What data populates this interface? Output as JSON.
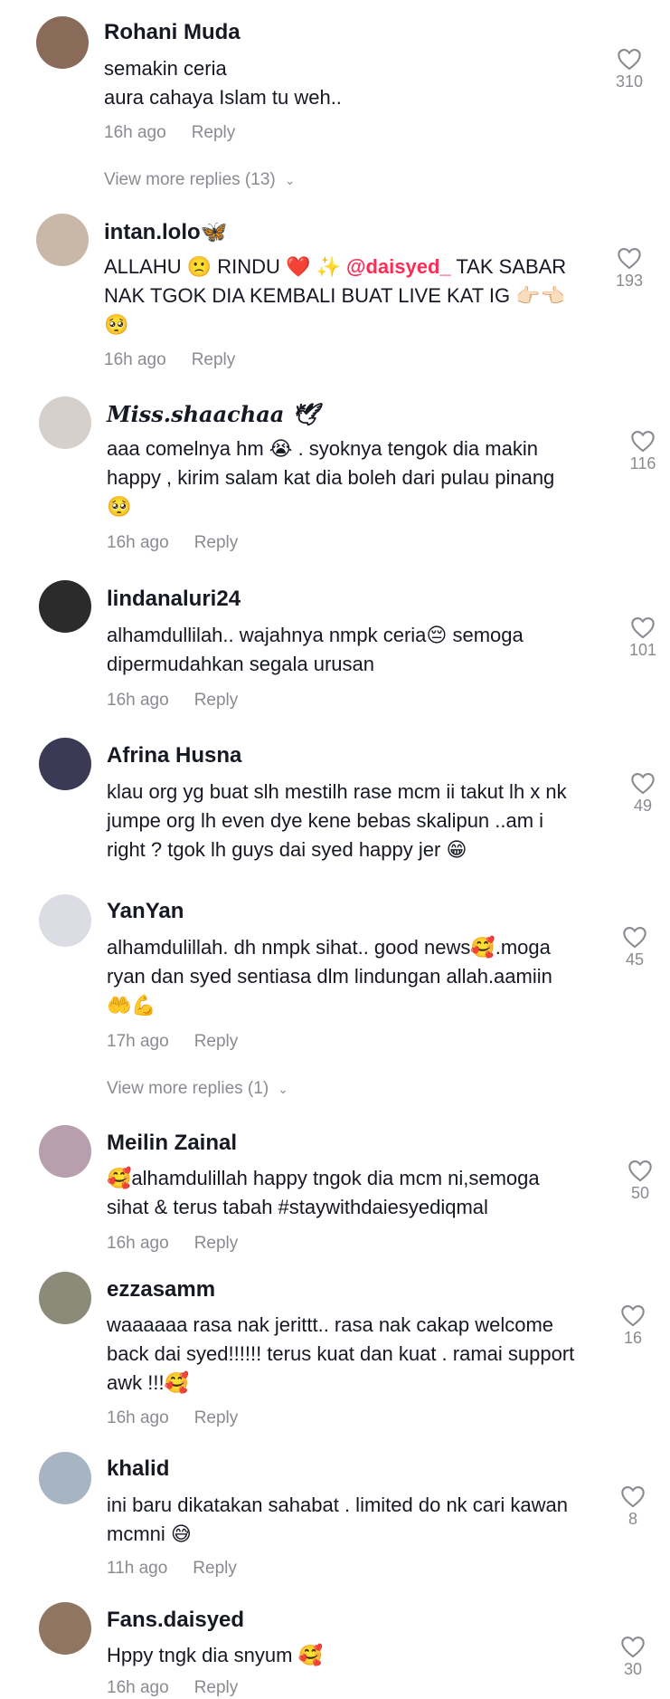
{
  "comments": [
    {
      "user": "Rohani Muda",
      "line1": "semakin ceria",
      "line2": "aura cahaya Islam tu weh..",
      "line3": "",
      "time": "16h ago",
      "reply": "Reply",
      "likes": "310",
      "more": "View more replies (13)",
      "avatar_color": "#8a6b5a"
    },
    {
      "user": "intan.lolo🦋",
      "line1": "ALLAHU 🙁 RINDU ❤️ ✨ ",
      "mention": "@daisyed_",
      "line1b": " TAK SABAR",
      "line2": "NAK TGOK DIA KEMBALI BUAT LIVE KAT IG 👉🏻👈🏻",
      "line3": "🥺",
      "time": "16h ago",
      "reply": "Reply",
      "likes": "193",
      "more": "",
      "avatar_color": "#c9b7a8"
    },
    {
      "user": "𝑴𝒊𝒔𝒔.𝒔𝒉𝒂𝒂𝒄𝒉𝒂𝒂 🕊",
      "line1": "aaa comelnya hm 😭 . syoknya tengok dia makin",
      "line2": "happy , kirim salam kat dia boleh dari pulau pinang",
      "line3": "🥺",
      "time": "16h ago",
      "reply": "Reply",
      "likes": "116",
      "more": "",
      "avatar_color": "#d6d0cc"
    },
    {
      "user": "lindanaluri24",
      "line1": "alhamdullilah.. wajahnya nmpk ceria😔 semoga",
      "line2": "dipermudahkan segala urusan",
      "line3": "",
      "time": "16h ago",
      "reply": "Reply",
      "likes": "101",
      "more": "",
      "avatar_color": "#2b2b2b"
    },
    {
      "user": "Afrina Husna",
      "line1": "klau org yg buat slh mestilh rase mcm ii takut lh x nk",
      "line2": "jumpe org lh even dye kene bebas skalipun ..am i",
      "line3": "right ? tgok lh guys dai syed happy jer 😁",
      "time": "",
      "reply": "",
      "likes": "49",
      "more": "",
      "avatar_color": "#3b3a55"
    },
    {
      "user": "YanYan",
      "line1": "alhamdulillah. dh nmpk sihat.. good news🥰.moga",
      "line2": "ryan dan syed sentiasa dlm lindungan allah.aamiin",
      "line3": "🤲💪",
      "time": "17h ago",
      "reply": "Reply",
      "likes": "45",
      "more": "View more replies (1)",
      "avatar_color": "#dcdde4"
    },
    {
      "user": "Meilin Zainal",
      "line1": "🥰alhamdulillah happy tngok dia mcm ni,semoga",
      "line2": "sihat & terus tabah #staywithdaiesyediqmal",
      "line3": "",
      "time": "16h ago",
      "reply": "Reply",
      "likes": "50",
      "more": "",
      "avatar_color": "#b79fae"
    },
    {
      "user": "ezzasamm",
      "line1": "waaaaaa rasa nak jerittt.. rasa nak cakap welcome",
      "line2": "back dai syed!!!!!! terus kuat dan kuat . ramai support",
      "line3": "awk !!!🥰",
      "time": "16h ago",
      "reply": "Reply",
      "likes": "16",
      "more": "",
      "avatar_color": "#8c8a78"
    },
    {
      "user": "khalid",
      "line1": "ini baru dikatakan sahabat . limited do nk cari kawan",
      "line2": "mcmni 😅",
      "line3": "",
      "time": "11h ago",
      "reply": "Reply",
      "likes": "8",
      "more": "",
      "avatar_color": "#a7b4c2"
    },
    {
      "user": "Fans.daisyed",
      "line1": "Hppy tngk dia snyum 🥰",
      "line2": "",
      "line3": "",
      "time": "16h ago",
      "reply": "Reply",
      "likes": "30",
      "more": "",
      "avatar_color": "#8f7663"
    }
  ]
}
